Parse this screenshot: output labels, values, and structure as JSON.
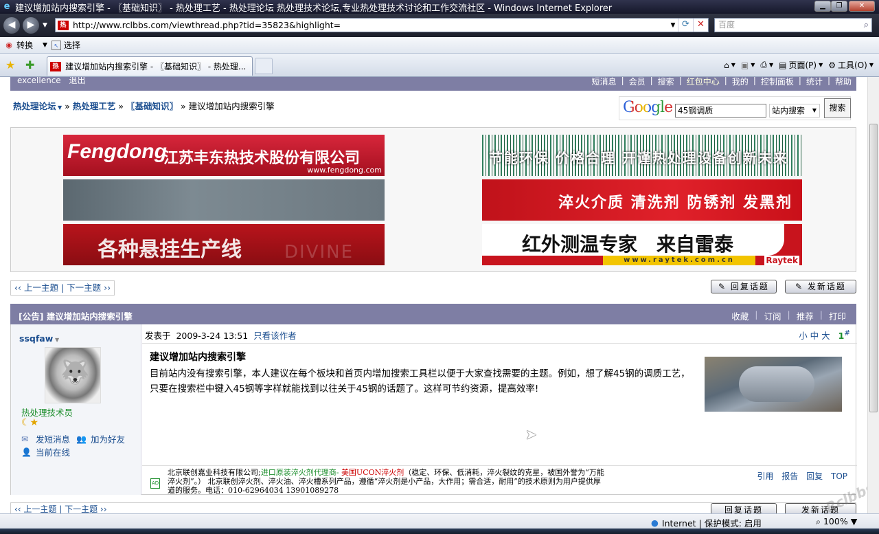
{
  "window": {
    "title": "建议增加站内搜索引擎 - 〖基础知识〗 - 热处理工艺 - 热处理论坛 热处理技术论坛,专业热处理技术讨论和工作交流社区 - Windows Internet Explorer",
    "favicon_text": "热"
  },
  "address": {
    "url": "http://www.rclbbs.com/viewthread.php?tid=35823&highlight="
  },
  "search_box": {
    "placeholder": "百度"
  },
  "command_bar": {
    "convert": "转换",
    "select": "选择"
  },
  "tab": {
    "title": "建议增加站内搜索引擎 - 〖基础知识〗 - 热处理..."
  },
  "toolbar": {
    "page": "页面(P)",
    "tools": "工具(O)"
  },
  "topnav": {
    "left": [
      "excellence",
      "退出"
    ],
    "right": [
      "短消息",
      "会员",
      "搜索",
      "红包中心",
      "我的",
      "控制面板",
      "统计",
      "帮助"
    ]
  },
  "breadcrumb": {
    "forum": "热处理论坛",
    "section": "热处理工艺",
    "sub": "〖基础知识〗",
    "current": "» 建议增加站内搜索引擎"
  },
  "google_search": {
    "logo": "Google",
    "query": "45钢调质",
    "scope": "站内搜索",
    "button": "搜索"
  },
  "ads": {
    "fengdong_brand": "Fengdong",
    "fengdong_name": "江苏丰东热技术股份有限公司",
    "fengdong_url": "www.fengdong.com",
    "divine_text": "各种悬挂生产线",
    "divine_wm": "DIVINE",
    "green_text": "节能环保 价格合理 开谨热处理设备创新未来",
    "quench_text": "淬火介质 清洗剂 防锈剂 发黑剂",
    "raytek_text": "红外测温专家　来自雷泰",
    "raytek_url": "www.raytek.com.cn",
    "raytek_brand": "Raytek"
  },
  "pager": {
    "prev": "‹‹ 上一主题",
    "next": "下一主题 ››"
  },
  "buttons": {
    "reply": "回复话题",
    "new": "发新话题"
  },
  "post_header": {
    "title": "[公告] 建议增加站内搜索引擎",
    "actions": [
      "收藏",
      "订阅",
      "推荐",
      "打印"
    ]
  },
  "author": {
    "name": "ssqfaw",
    "rank": "热处理技术员",
    "stars": "☾★",
    "send_msg": "发短消息",
    "add_friend": "加为好友",
    "online": "当前在线"
  },
  "post": {
    "posted_label": "发表于",
    "time": "2009-3-24 13:51",
    "only_author": "只看该作者",
    "font_sizes": "小 中 大",
    "floor": "1",
    "floor_mark": "#",
    "title": "建议增加站内搜索引擎",
    "content": "目前站内没有搜索引擎，本人建议在每个板块和首页内增加搜索工具栏以便于大家查找需要的主题。例如，想了解45钢的调质工艺，只要在搜索栏中键入45钢等字样就能找到以往关于45钢的话题了。这样可节约资源，提高效率!"
  },
  "signature": {
    "ad_tag": "AD",
    "company": "北京联创嘉业科技有限公司;",
    "link1": "进口原装淬火剂代理商- ",
    "link2": "美国UCON淬火剂",
    "text": "（稳定、环保、低消耗，淬火裂纹的克星，被国外誉为“万能淬火剂”。） 北京联创淬火剂、淬火油、淬火槽系列产品，遵循“淬火剂是小产品，大作用；需合适，耐用”的技术原则为用户提供厚道的服务。电话：010-62964034 13901089278",
    "actions": [
      "引用",
      "报告",
      "回复",
      "TOP"
    ]
  },
  "bottom_pager": "‹‹ 上一主题 | 下一主题 ››",
  "watermark": "Rclbbs",
  "status": {
    "zone": "Internet | 保护模式: 启用",
    "zoom": "100%"
  }
}
